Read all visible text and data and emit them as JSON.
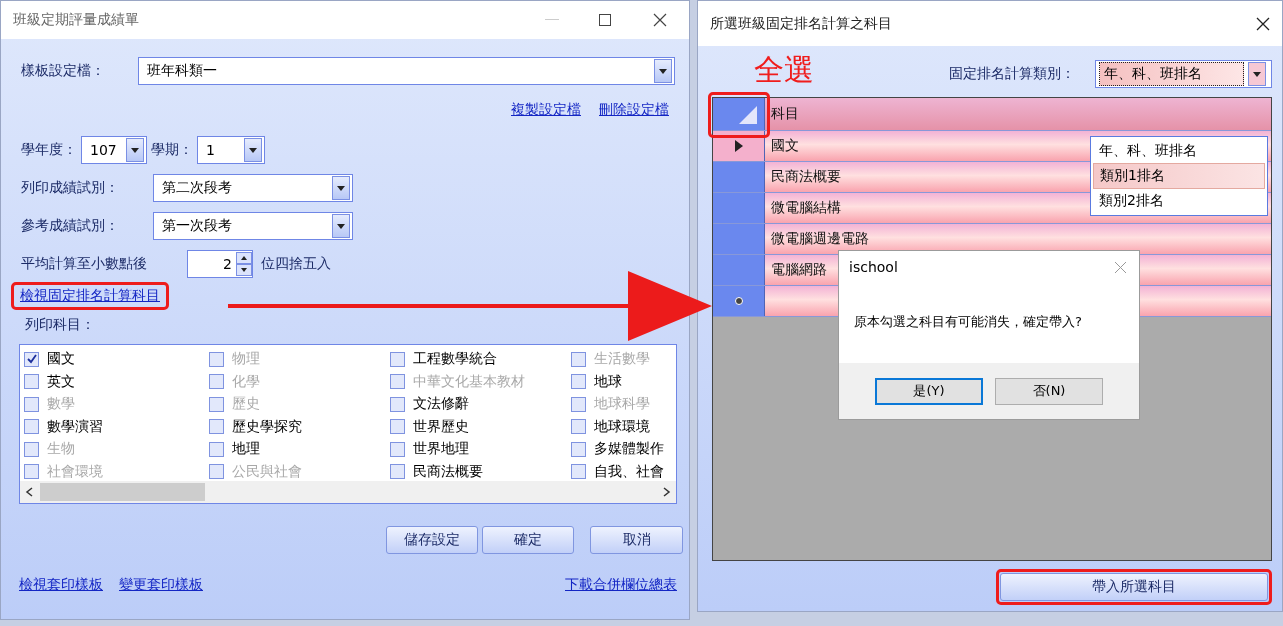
{
  "settings_window": {
    "title": "班級定期評量成績單",
    "template_label": "樣板設定檔：",
    "template_value": "班年科類一",
    "links": [
      "複製設定檔",
      "刪除設定檔"
    ],
    "year_label": "學年度：",
    "year_value": "107",
    "semester_label": "學期：",
    "semester_value": "1",
    "print_exam_label": "列印成績試別：",
    "print_exam_value": "第二次段考",
    "ref_exam_label": "參考成績試別：",
    "ref_exam_value": "第一次段考",
    "avg_label": "平均計算至小數點後",
    "avg_value": "2",
    "avg_suffix": "位四捨五入",
    "view_link": "檢視固定排名計算科目",
    "subjects_label": "列印科目：",
    "subjects": [
      {
        "label": "國文",
        "checked": true,
        "disabled": false
      },
      {
        "label": "物理",
        "checked": false,
        "disabled": true
      },
      {
        "label": "工程數學統合",
        "checked": false,
        "disabled": false
      },
      {
        "label": "生活數學",
        "checked": false,
        "disabled": true
      },
      {
        "label": "英文",
        "checked": false,
        "disabled": false
      },
      {
        "label": "化學",
        "checked": false,
        "disabled": true
      },
      {
        "label": "中華文化基本教材",
        "checked": false,
        "disabled": true
      },
      {
        "label": "地球",
        "checked": false,
        "disabled": false
      },
      {
        "label": "數學",
        "checked": false,
        "disabled": true
      },
      {
        "label": "歷史",
        "checked": false,
        "disabled": true
      },
      {
        "label": "文法修辭",
        "checked": false,
        "disabled": false
      },
      {
        "label": "地球科學",
        "checked": false,
        "disabled": true
      },
      {
        "label": "數學演習",
        "checked": false,
        "disabled": false
      },
      {
        "label": "歷史學探究",
        "checked": false,
        "disabled": false
      },
      {
        "label": "世界歷史",
        "checked": false,
        "disabled": false
      },
      {
        "label": "地球環境",
        "checked": false,
        "disabled": false
      },
      {
        "label": "生物",
        "checked": false,
        "disabled": true
      },
      {
        "label": "地理",
        "checked": false,
        "disabled": false
      },
      {
        "label": "世界地理",
        "checked": false,
        "disabled": false
      },
      {
        "label": "多媒體製作",
        "checked": false,
        "disabled": false
      },
      {
        "label": "社會環境",
        "checked": false,
        "disabled": true
      },
      {
        "label": "公民與社會",
        "checked": false,
        "disabled": true
      },
      {
        "label": "民商法概要",
        "checked": false,
        "disabled": false
      },
      {
        "label": "自我、社會",
        "checked": false,
        "disabled": false
      }
    ],
    "buttons": [
      "儲存設定",
      "確定",
      "取消"
    ],
    "footer_links": [
      "檢視套印樣板",
      "變更套印樣板"
    ],
    "footer_link_right": "下載合併欄位總表"
  },
  "rank_window": {
    "title": "所選班級固定排名計算之科目",
    "select_all_note": "全選",
    "category_label": "固定排名計算類別：",
    "category_value": "年、科、班排名",
    "category_options": [
      {
        "label": "年、科、班排名",
        "selected": false
      },
      {
        "label": "類別1排名",
        "selected": true
      },
      {
        "label": "類別2排名",
        "selected": false
      }
    ],
    "column_header": "科目",
    "rows": [
      {
        "kind": "data",
        "name": "國文",
        "current": true
      },
      {
        "kind": "data",
        "name": "民商法概要",
        "current": false
      },
      {
        "kind": "data",
        "name": "微電腦結構",
        "current": false
      },
      {
        "kind": "data",
        "name": "微電腦週邊電路",
        "current": false
      },
      {
        "kind": "data",
        "name": "電腦網路",
        "current": false
      },
      {
        "kind": "new",
        "current": false
      }
    ],
    "apply_button": "帶入所選科目"
  },
  "dialog": {
    "title": "ischool",
    "message": "原本勾選之科目有可能消失，確定帶入?",
    "buttons": [
      {
        "label": "是(Y)",
        "selected": true
      },
      {
        "label": "否(N)",
        "selected": false
      }
    ]
  }
}
